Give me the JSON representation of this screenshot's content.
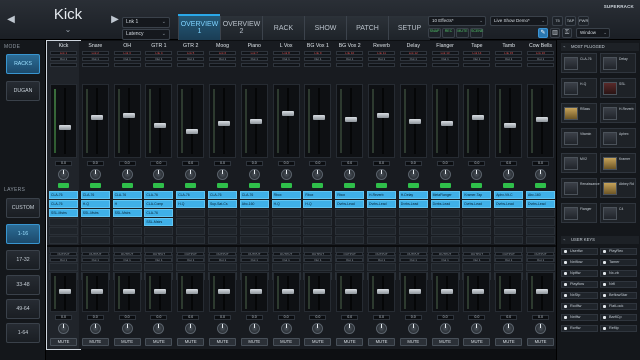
{
  "header": {
    "track_name": "Kick",
    "layer_select": "Lnk 1",
    "latency_select": "Latency",
    "tabs": [
      {
        "label": "OVERVIEW 1",
        "active": true
      },
      {
        "label": "OVERVIEW 2",
        "active": false
      },
      {
        "label": "RACK",
        "active": false
      },
      {
        "label": "SHOW",
        "active": false
      },
      {
        "label": "PATCH",
        "active": false
      },
      {
        "label": "SETUP",
        "active": false
      }
    ],
    "effects_select": "10 Effects*",
    "show_select": "Live Show Demo*",
    "bpm": "75",
    "tap_label": "TAP",
    "pwr_label": "PWR",
    "status_buttons": [
      "SNAP",
      "REC",
      "MUTE",
      "SCENE"
    ],
    "window_select": "Window",
    "logo": "SUPERRACK"
  },
  "sidebar": {
    "mode_title": "MODE",
    "modes": [
      {
        "label": "RACKS",
        "active": true
      },
      {
        "label": "DUGAN",
        "active": false
      }
    ],
    "layers_title": "LAYERS",
    "layers": [
      {
        "label": "CUSTOM",
        "active": false
      },
      {
        "label": "1-16",
        "active": true
      },
      {
        "label": "17-32",
        "active": false
      },
      {
        "label": "33-48",
        "active": false
      },
      {
        "label": "49-64",
        "active": false
      },
      {
        "label": "1-64",
        "active": false
      }
    ]
  },
  "channels": [
    {
      "name": "Kick",
      "input": "Lnk 1",
      "out": "Out 1",
      "val": "0.0",
      "inserts": [
        "CLA-76",
        "CLA-76",
        "SSL-Mstrs"
      ]
    },
    {
      "name": "Snare",
      "input": "Lnk 2",
      "out": "Out 1",
      "val": "0.0",
      "inserts": [
        "CLA-76",
        "H-Q",
        "SSL-Mstrs"
      ]
    },
    {
      "name": "OH",
      "input": "Lnk 3",
      "out": "Out 1",
      "val": "0.0",
      "inserts": [
        "CLA-76",
        "H",
        "SSL-Mstrs"
      ]
    },
    {
      "name": "GTR 1",
      "input": "Lnk 4",
      "out": "Out 1",
      "val": "0.0",
      "inserts": [
        "CLA-76",
        "CLA-Comp",
        "CLA-76",
        "SSL-Mstrs"
      ]
    },
    {
      "name": "GTR 2",
      "input": "Lnk 5",
      "out": "Out 1",
      "val": "0.0",
      "inserts": [
        "CLA-76",
        "H-Q"
      ]
    },
    {
      "name": "Moog",
      "input": "Lnk 6",
      "out": "Out 1",
      "val": "0.0",
      "inserts": [
        "CLA-76",
        "Sup-Sat-Cs"
      ]
    },
    {
      "name": "Piano",
      "input": "Lnk 7",
      "out": "Out 1",
      "val": "0.0",
      "inserts": [
        "CLA-76",
        "Abc-160"
      ]
    },
    {
      "name": "L Vox",
      "input": "Lnk 8",
      "out": "Out 1",
      "val": "0.0",
      "inserts": [
        "Rbox",
        "H-Q"
      ]
    },
    {
      "name": "BG Vox 1",
      "input": "Lnk 9",
      "out": "Out 1",
      "val": "0.0",
      "inserts": [
        "Rbox",
        "H-Q"
      ]
    },
    {
      "name": "BG Vox 2",
      "input": "Lnk 10",
      "out": "Out 1",
      "val": "0.0",
      "inserts": [
        "Rbox",
        "Dvrbs-Lead"
      ]
    },
    {
      "name": "Reverb",
      "input": "Lnk 11",
      "out": "Out 1",
      "val": "0.0",
      "inserts": [
        "H-Reverb",
        "Dvrbs-Lead"
      ]
    },
    {
      "name": "Delay",
      "input": "Lnk 12",
      "out": "Out 1",
      "val": "0.0",
      "inserts": [
        "H-Delay",
        "Dvrbs-Lead"
      ]
    },
    {
      "name": "Flanger",
      "input": "Lnk 13",
      "out": "Out 1",
      "val": "0.0",
      "inserts": [
        "MetaFlanger",
        "Dvrbs-Lead"
      ]
    },
    {
      "name": "Tape",
      "input": "Lnk 14",
      "out": "Out 1",
      "val": "0.0",
      "inserts": [
        "Kramer-Tap",
        "Dvrbs-Lead"
      ]
    },
    {
      "name": "Tamb",
      "input": "Lnk 15",
      "out": "Out 1",
      "val": "0.0",
      "inserts": [
        "Aphx-Vit-C",
        "Dvrbs-Lead"
      ]
    },
    {
      "name": "Cow Bells",
      "input": "Lnk 16",
      "out": "Out 1",
      "val": "0.0",
      "inserts": [
        "Abc-160",
        "Dvrbs-Lead"
      ]
    }
  ],
  "bottom_label": "OUTPUT",
  "mute_label": "MUTE",
  "right_panel": {
    "plugins_title": "MOST PLUGGED",
    "plugins": [
      {
        "label": "CLA-76",
        "style": "dark"
      },
      {
        "label": "Delay",
        "style": "dark"
      },
      {
        "label": "H-Q",
        "style": "dark"
      },
      {
        "label": "SSL",
        "style": "red"
      },
      {
        "label": "RBass",
        "style": "gold"
      },
      {
        "label": "H-Reverb",
        "style": "dark"
      },
      {
        "label": "Vitamin",
        "style": "dark"
      },
      {
        "label": "Aphex",
        "style": "dark"
      },
      {
        "label": "MV2",
        "style": "dark"
      },
      {
        "label": "Kramer",
        "style": "gold"
      },
      {
        "label": "Renaissance",
        "style": "dark"
      },
      {
        "label": "Abbey Rd",
        "style": "gold"
      },
      {
        "label": "Flanger",
        "style": "dark"
      },
      {
        "label": "C4",
        "style": "dark"
      }
    ],
    "keys_title": "USER KEYS",
    "keys": [
      "Userflw",
      "PlayRec",
      "Nxtflow",
      "Tamer",
      "Nptflw",
      "Nx-vb",
      "Playflow",
      "Nrfl",
      "NxStp",
      "BeflowStar",
      "Rcdflw",
      "FlatLock",
      "Nxtflw",
      "BarflCp",
      "Rcrflw",
      "Reflip"
    ]
  },
  "colors": {
    "accent": "#2aa8e8",
    "insert": "#3fb0e8",
    "meter_green": "#2fbf4a"
  }
}
